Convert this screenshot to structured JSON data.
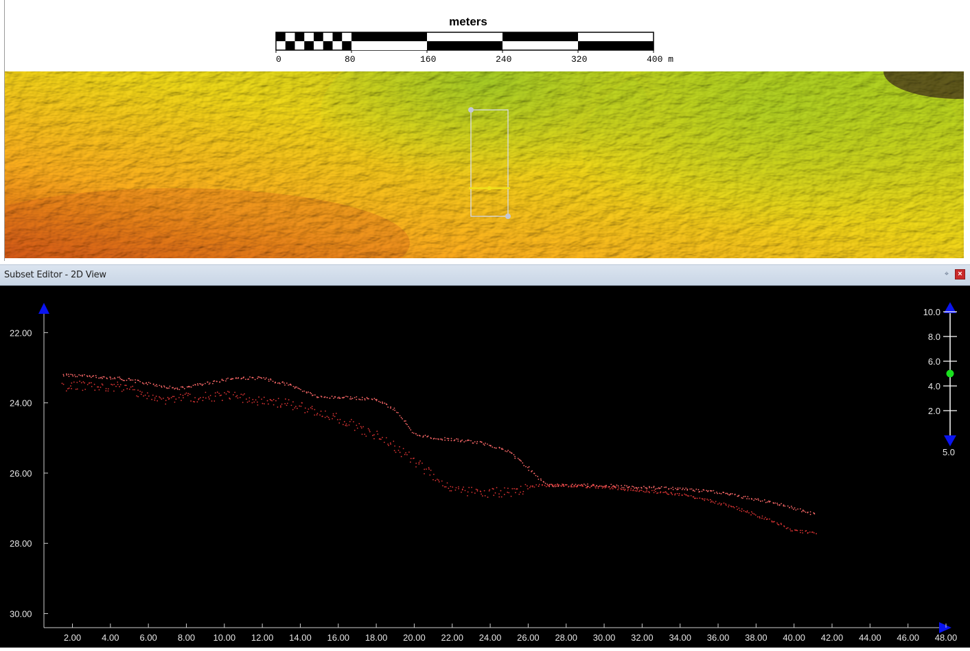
{
  "scale_bar": {
    "title": "meters",
    "ticks": [
      "0",
      "80",
      "160",
      "240",
      "320",
      "400 m"
    ]
  },
  "map_view": {
    "colors": [
      "#c94e10",
      "#f2a61c",
      "#e6cf18",
      "#a3c81e"
    ],
    "selection_tool": "rectangle-subset-selector"
  },
  "subset_editor": {
    "title": "Subset Editor - 2D View",
    "pin_icon": "pin-icon",
    "close_icon": "close-icon",
    "chart_data": {
      "type": "scatter",
      "x_ticks": [
        "2.00",
        "4.00",
        "6.00",
        "8.00",
        "10.00",
        "12.00",
        "14.00",
        "16.00",
        "18.00",
        "20.00",
        "22.00",
        "24.00",
        "26.00",
        "28.00",
        "30.00",
        "32.00",
        "34.00",
        "36.00",
        "38.00",
        "40.00",
        "42.00",
        "44.00",
        "46.00",
        "48.00"
      ],
      "y_ticks": [
        "22.00",
        "24.00",
        "26.00",
        "28.00",
        "30.00"
      ],
      "xlim": [
        0.5,
        48
      ],
      "ylim": [
        21.25,
        30.4
      ],
      "y_inverted": true,
      "grid": false,
      "series": [
        {
          "color": "#ff6a6a",
          "x": [
            1.5,
            3,
            4.5,
            6,
            7.5,
            9,
            10.5,
            12,
            13.5,
            15,
            16.5,
            18,
            19,
            20,
            21,
            22,
            23,
            24,
            25,
            26,
            27,
            28,
            30,
            32,
            34,
            36,
            38,
            39,
            40,
            41.2
          ],
          "y": [
            23.2,
            23.25,
            23.3,
            23.45,
            23.6,
            23.45,
            23.3,
            23.3,
            23.5,
            23.85,
            23.85,
            23.9,
            24.2,
            24.9,
            25.0,
            25.05,
            25.1,
            25.2,
            25.4,
            25.85,
            26.35,
            26.35,
            26.35,
            26.4,
            26.45,
            26.55,
            26.75,
            26.85,
            27.0,
            27.2
          ]
        },
        {
          "color": "#e03535",
          "x": [
            1.5,
            3,
            4.5,
            5.5,
            6.5,
            8,
            10,
            12,
            13.5,
            15,
            16.5,
            17.5,
            18.5,
            19.5,
            20.5,
            21.5,
            22.5,
            23.5,
            24.5,
            25.5,
            26.5,
            28,
            30,
            32,
            34,
            35,
            36,
            37,
            38,
            39,
            40,
            41.2
          ],
          "y": [
            23.55,
            23.5,
            23.55,
            23.7,
            23.95,
            23.85,
            23.8,
            23.95,
            24.05,
            24.25,
            24.55,
            24.85,
            25.05,
            25.45,
            25.85,
            26.3,
            26.5,
            26.55,
            26.55,
            26.5,
            26.35,
            26.35,
            26.4,
            26.5,
            26.6,
            26.7,
            26.85,
            27.0,
            27.2,
            27.4,
            27.65,
            27.7
          ]
        }
      ]
    },
    "side_scale": {
      "ticks": [
        "10.0",
        "8.0",
        "6.0",
        "4.0",
        "2.0"
      ],
      "bottom_label": "5.0",
      "value": 5.0,
      "min": 0.0,
      "max": 10.0,
      "knob_color": "#19e01e",
      "arrow_color": "#0a14f0"
    },
    "axis_arrow_color": "#0a14f0"
  }
}
